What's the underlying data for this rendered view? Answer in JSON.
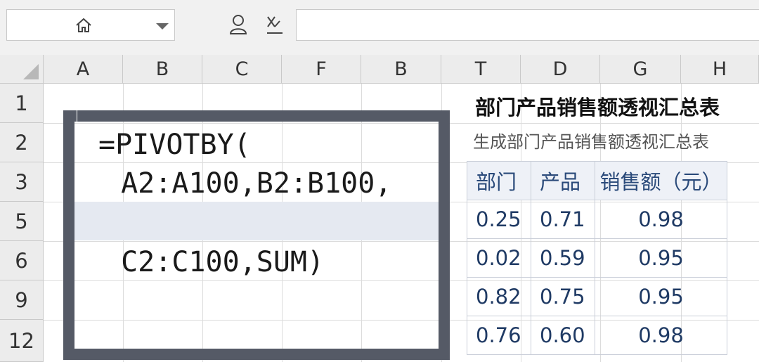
{
  "name_box": {
    "icon": "home-icon",
    "dropdown_icon": "chevron-down-icon"
  },
  "formula_bar": {
    "cancel_icon": "user-icon",
    "function_icon": "x-icon",
    "value": ""
  },
  "columns": [
    "A",
    "B",
    "C",
    "F",
    "B",
    "T",
    "D",
    "G",
    "H"
  ],
  "rows": [
    "1",
    "2",
    "3",
    "5",
    "6",
    "9",
    "12"
  ],
  "formula": {
    "line1": "=PIVOTBY(",
    "line2": " A2:A100,B2:B100,",
    "line3": " C2:C100,SUM)"
  },
  "panel": {
    "title": "部门产品销售额透视汇总表",
    "subtitle": "生成部门产品销售额透视汇总表",
    "headers": [
      "部门",
      "产品",
      "销售额（元）"
    ],
    "rows": [
      [
        "0.25",
        "0.71",
        "0.98"
      ],
      [
        "0.02",
        "0.59",
        "0.95"
      ],
      [
        "0.82",
        "0.75",
        "0.95"
      ],
      [
        "0.76",
        "0.60",
        "0.98"
      ]
    ]
  },
  "colors": {
    "frame": "#555a66",
    "header_bg": "#ececec",
    "table_text": "#1f3a64"
  }
}
